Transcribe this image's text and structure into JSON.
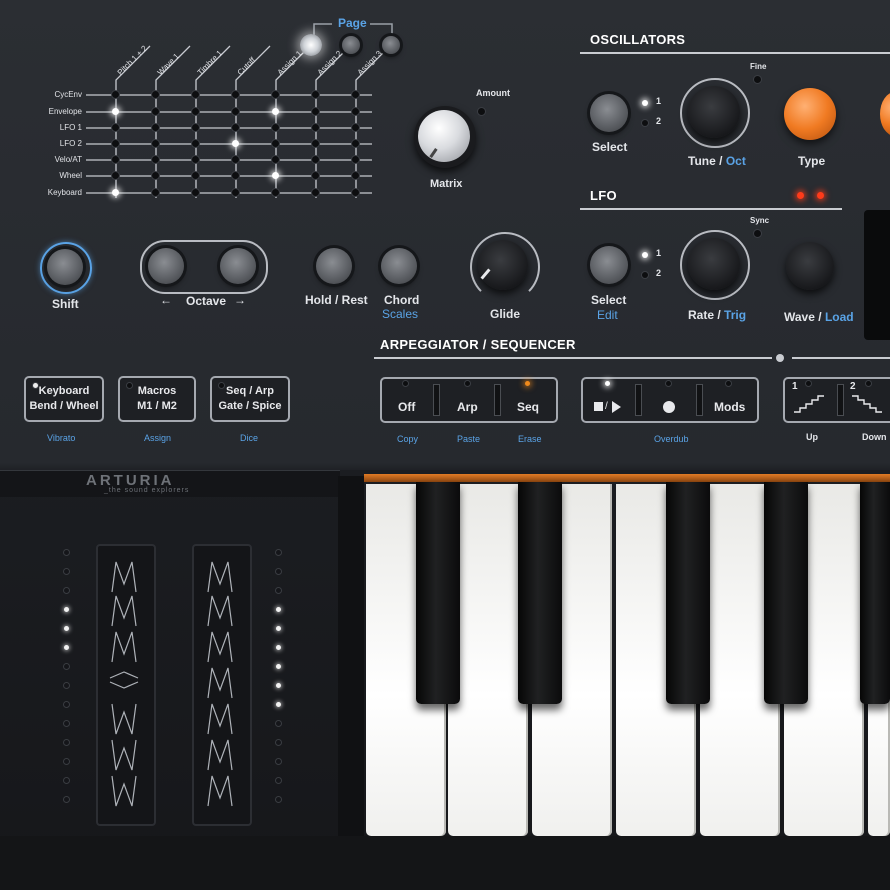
{
  "matrix": {
    "page_label": "Page",
    "columns": [
      "Pitch 1 + 2",
      "Wave 1",
      "Timbre 1",
      "Cutoff",
      "Assign 1",
      "Assign 2",
      "Assign 3"
    ],
    "rows": [
      "CycEnv",
      "Envelope",
      "LFO 1",
      "LFO 2",
      "Velo/AT",
      "Wheel",
      "Keyboard"
    ],
    "knob_label": "Matrix",
    "amount_label": "Amount"
  },
  "oscillators": {
    "title": "OSCILLATORS",
    "select_label": "Select",
    "led_1": "1",
    "led_2": "2",
    "fine_label": "Fine",
    "tune_label": "Tune",
    "tune_sep": "/",
    "tune_alt": "Oct",
    "type_label": "Type"
  },
  "lfo": {
    "title": "LFO",
    "select_label": "Select",
    "select_alt": "Edit",
    "led_1": "1",
    "led_2": "2",
    "sync_label": "Sync",
    "rate_label": "Rate",
    "rate_sep": "/",
    "rate_alt": "Trig",
    "wave_label": "Wave",
    "wave_sep": "/",
    "wave_alt": "Load"
  },
  "performance": {
    "shift_label": "Shift",
    "octave_label": "Octave",
    "octave_down": "←",
    "octave_up": "→",
    "hold_label": "Hold / Rest",
    "chord_label": "Chord",
    "chord_alt": "Scales",
    "glide_label": "Glide"
  },
  "left_buttons": [
    {
      "line1": "Keyboard",
      "line2": "Bend / Wheel",
      "alt": "Vibrato"
    },
    {
      "line1": "Macros",
      "line2": "M1 / M2",
      "alt": "Assign"
    },
    {
      "line1": "Seq / Arp",
      "line2": "Gate / Spice",
      "alt": "Dice"
    }
  ],
  "arp": {
    "title": "ARPEGGIATOR / SEQUENCER",
    "mode_buttons": [
      "Off",
      "Arp",
      "Seq"
    ],
    "mode_alts": [
      "Copy",
      "Paste",
      "Erase"
    ],
    "mods_label": "Mods",
    "overdub_label": "Overdub",
    "up_num": "1",
    "down_num": "2",
    "up_label": "Up",
    "down_label": "Down"
  },
  "brand": {
    "name": "ARTURIA",
    "tagline": "_the sound explorers"
  },
  "colors": {
    "accent_blue": "#5aa3e6",
    "orange": "#f08a1c",
    "panel": "#2b2e33"
  }
}
